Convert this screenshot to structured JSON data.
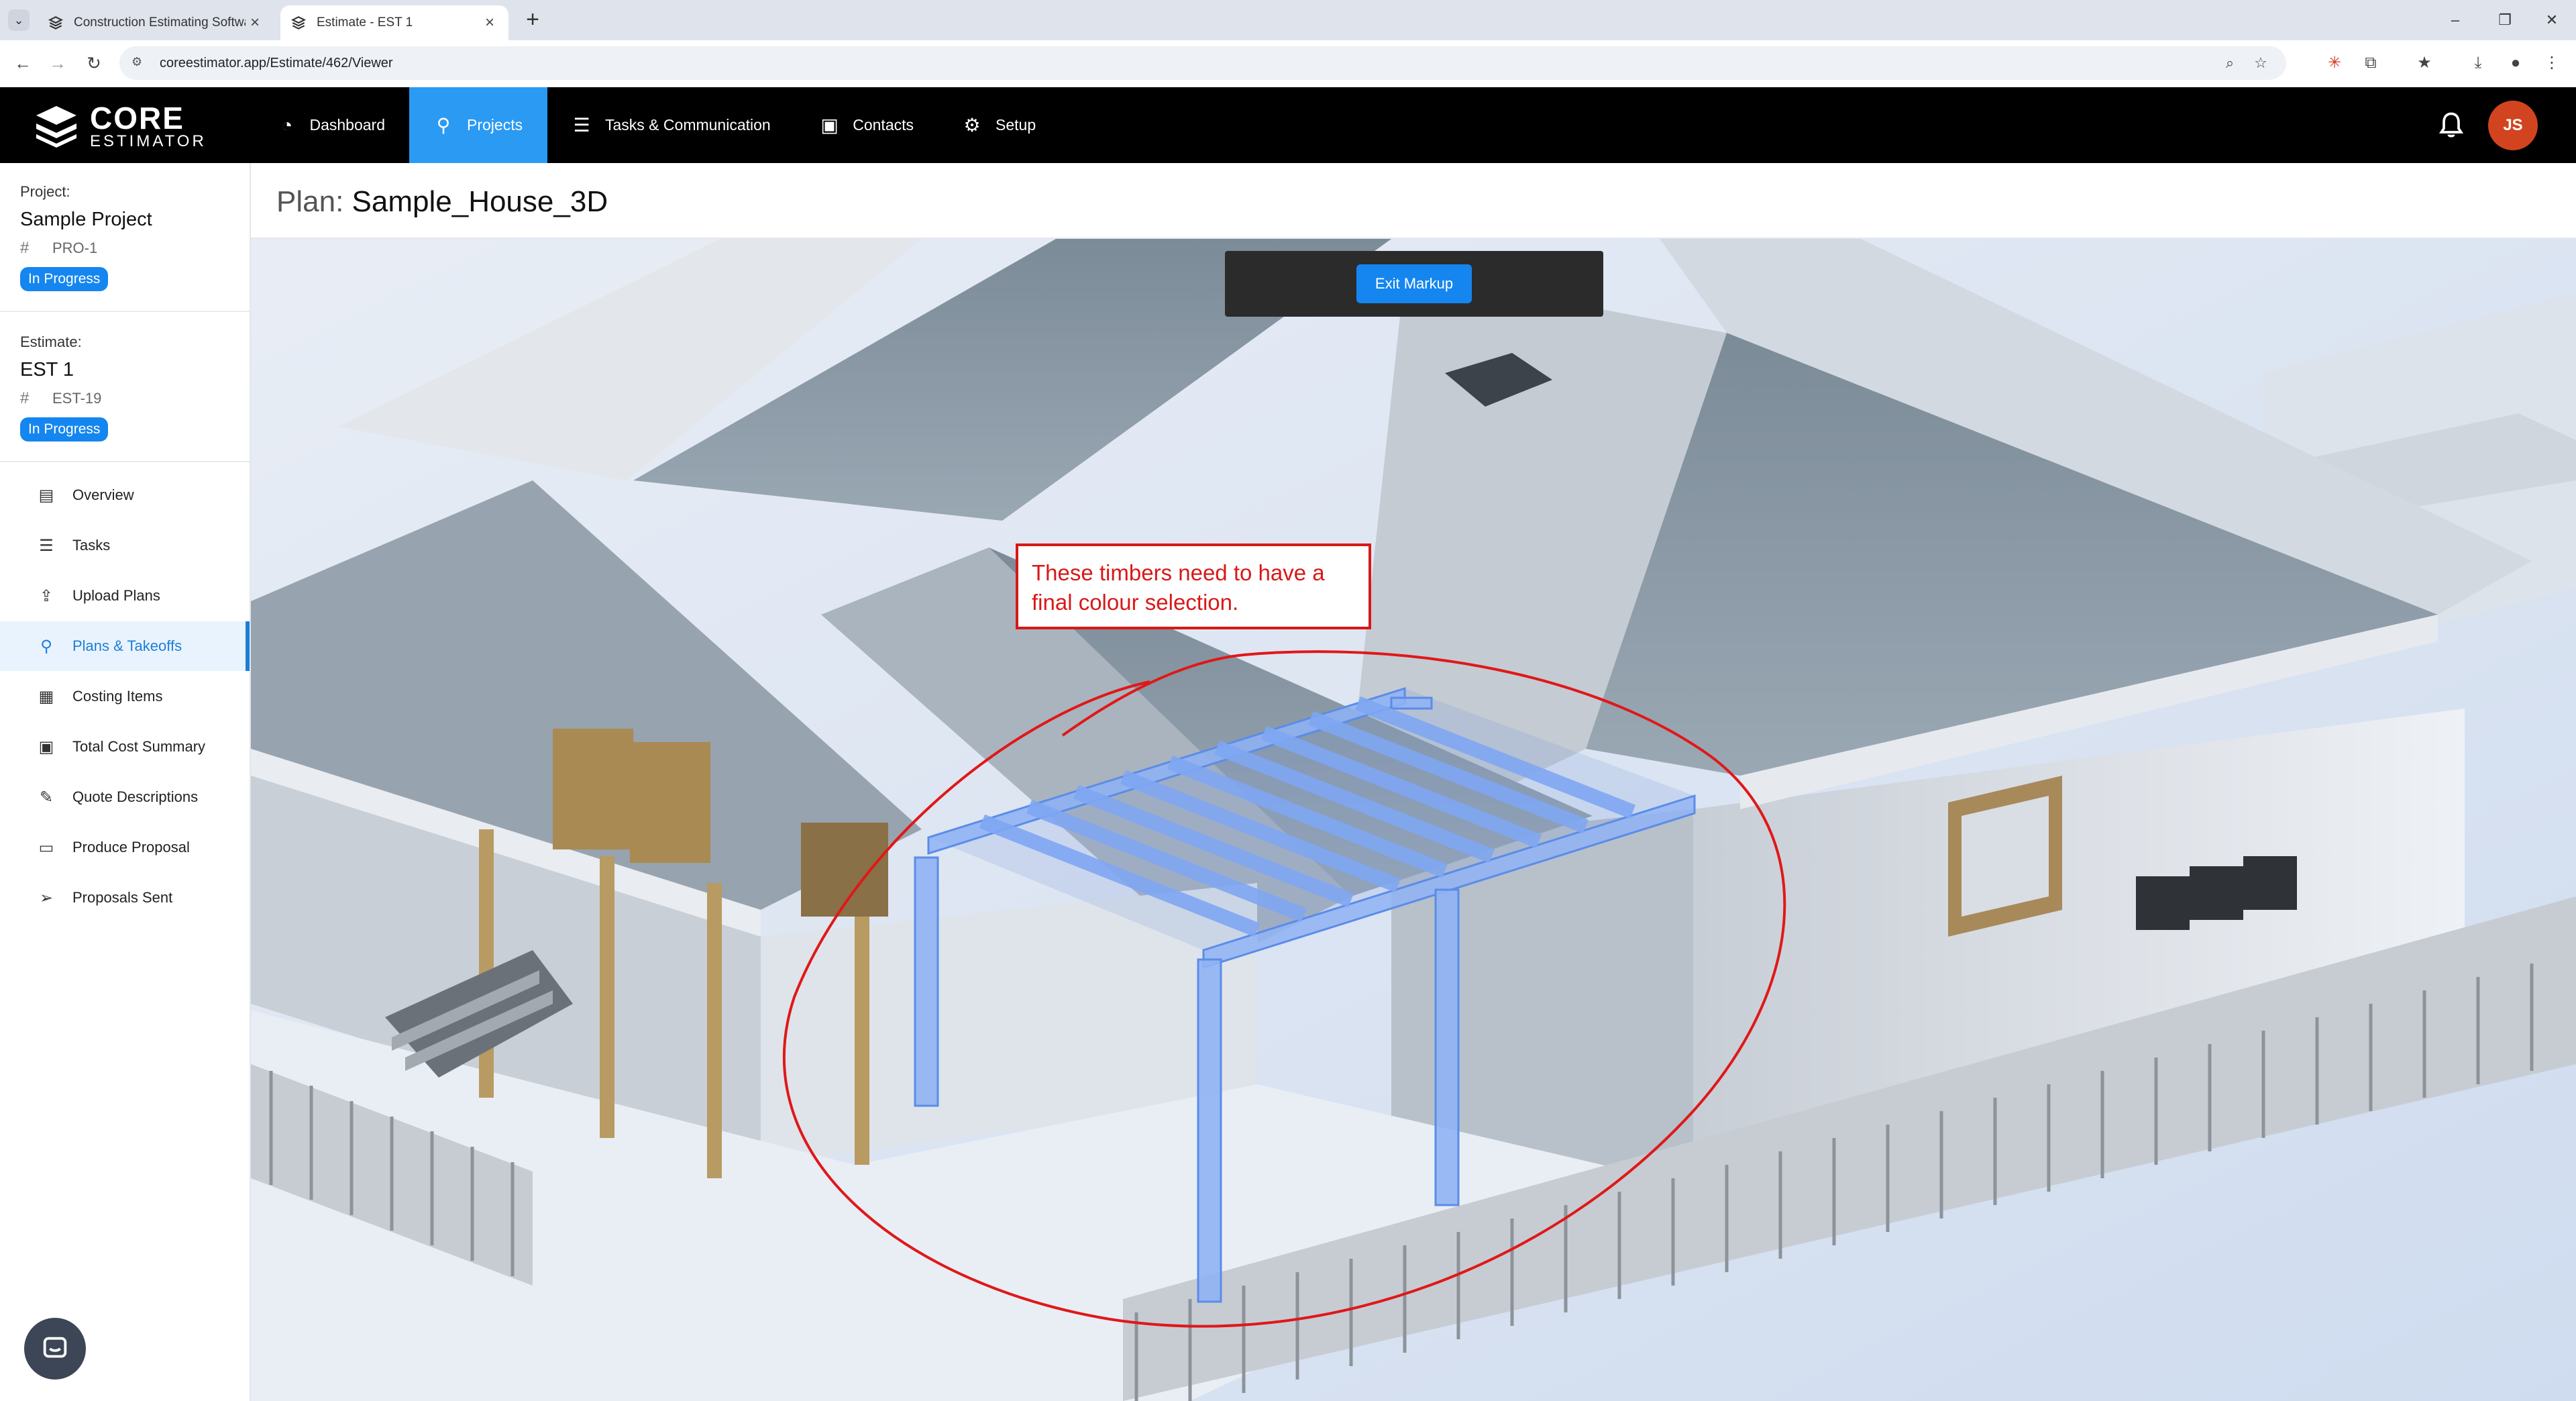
{
  "browser": {
    "tabs": [
      {
        "title": "Construction Estimating Softwa"
      },
      {
        "title": "Estimate - EST 1"
      }
    ],
    "url": "coreestimator.app/Estimate/462/Viewer"
  },
  "app": {
    "logo": {
      "line1": "CORE",
      "line2": "ESTIMATOR"
    },
    "nav": [
      {
        "label": "Dashboard",
        "icon": "dashboard-icon"
      },
      {
        "label": "Projects",
        "icon": "person-icon"
      },
      {
        "label": "Tasks & Communication",
        "icon": "checklist-icon"
      },
      {
        "label": "Contacts",
        "icon": "contacts-icon"
      },
      {
        "label": "Setup",
        "icon": "gear-icon"
      }
    ],
    "user_initials": "JS"
  },
  "sidebar": {
    "project": {
      "label": "Project:",
      "name": "Sample Project",
      "code": "PRO-1",
      "status": "In Progress"
    },
    "estimate": {
      "label": "Estimate:",
      "name": "EST 1",
      "code": "EST-19",
      "status": "In Progress"
    },
    "menu": [
      {
        "label": "Overview",
        "icon": "overview-icon"
      },
      {
        "label": "Tasks",
        "icon": "tasks-icon"
      },
      {
        "label": "Upload Plans",
        "icon": "upload-icon"
      },
      {
        "label": "Plans & Takeoffs",
        "icon": "plans-icon"
      },
      {
        "label": "Costing Items",
        "icon": "table-icon"
      },
      {
        "label": "Total Cost Summary",
        "icon": "summary-icon"
      },
      {
        "label": "Quote Descriptions",
        "icon": "edit-icon"
      },
      {
        "label": "Produce Proposal",
        "icon": "proposal-icon"
      },
      {
        "label": "Proposals Sent",
        "icon": "send-icon"
      }
    ]
  },
  "main": {
    "plan_prefix": "Plan:",
    "plan_name": "Sample_House_3D",
    "exit_markup_label": "Exit Markup",
    "annotation": "These timbers need to have a final colour selection."
  }
}
